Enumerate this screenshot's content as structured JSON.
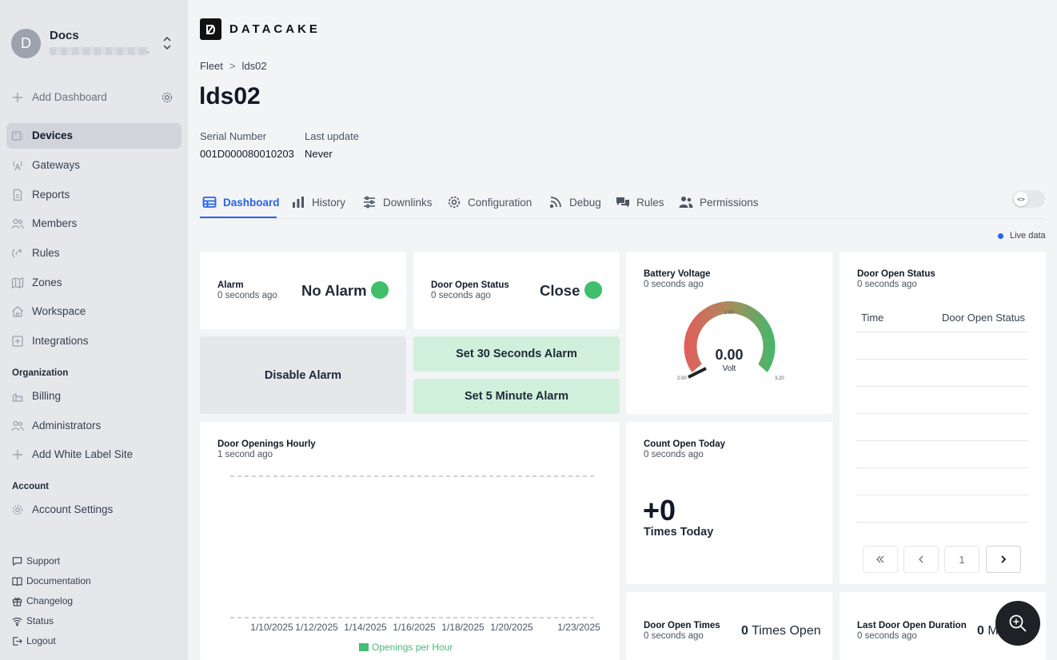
{
  "workspace": {
    "initial": "D",
    "name": "Docs",
    "sub_suffix": ".."
  },
  "sidebar": {
    "add_dashboard": "Add Dashboard",
    "items": [
      {
        "label": "Devices"
      },
      {
        "label": "Gateways"
      },
      {
        "label": "Reports"
      },
      {
        "label": "Members"
      },
      {
        "label": "Rules"
      },
      {
        "label": "Zones"
      },
      {
        "label": "Workspace"
      },
      {
        "label": "Integrations"
      }
    ],
    "org_heading": "Organization",
    "org_items": [
      {
        "label": "Billing"
      },
      {
        "label": "Administrators"
      },
      {
        "label": "Add White Label Site"
      }
    ],
    "account_heading": "Account",
    "account_items": [
      {
        "label": "Account Settings"
      }
    ],
    "footer": [
      {
        "label": "Support"
      },
      {
        "label": "Documentation"
      },
      {
        "label": "Changelog"
      },
      {
        "label": "Status"
      },
      {
        "label": "Logout"
      }
    ]
  },
  "brand": {
    "name": "DATACAKE"
  },
  "breadcrumb": {
    "parent": "Fleet",
    "sep": ">",
    "current": "lds02"
  },
  "device": {
    "title": "lds02",
    "serial_label": "Serial Number",
    "serial_value": "001D000080010203",
    "last_update_label": "Last update",
    "last_update_value": "Never"
  },
  "tabs": [
    {
      "label": "Dashboard",
      "icon": "table-icon"
    },
    {
      "label": "History",
      "icon": "bar-chart-icon"
    },
    {
      "label": "Downlinks",
      "icon": "sliders-icon"
    },
    {
      "label": "Configuration",
      "icon": "gear-icon"
    },
    {
      "label": "Debug",
      "icon": "rss-icon"
    },
    {
      "label": "Rules",
      "icon": "chat-icon"
    },
    {
      "label": "Permissions",
      "icon": "users-icon"
    }
  ],
  "live_data": "Live data",
  "widgets": {
    "alarm": {
      "title": "Alarm",
      "sub": "0 seconds ago",
      "value": "No Alarm"
    },
    "door_status": {
      "title": "Door Open Status",
      "sub": "0 seconds ago",
      "value": "Close"
    },
    "battery": {
      "title": "Battery Voltage",
      "sub": "0 seconds ago",
      "value": "0.00",
      "unit": "Volt",
      "min": "2.00",
      "mid": "2.60",
      "max": "3.20",
      "level": 0
    },
    "door_table": {
      "title": "Door Open Status",
      "sub": "0 seconds ago",
      "col_time": "Time",
      "col_status": "Door Open Status",
      "page": "1"
    },
    "buttons": {
      "disable": "Disable Alarm",
      "set30": "Set 30 Seconds Alarm",
      "set5": "Set 5 Minute Alarm"
    },
    "hourly": {
      "title": "Door Openings Hourly",
      "sub": "1 second ago"
    },
    "count_today": {
      "title": "Count Open Today",
      "sub": "0 seconds ago",
      "value": "+0",
      "label": "Times Today"
    },
    "open_times": {
      "title": "Door Open Times",
      "sub": "0 seconds ago",
      "value": "0",
      "unit": "Times Open"
    },
    "last_duration": {
      "title": "Last Door Open Duration",
      "sub": "0 seconds ago",
      "value": "0",
      "unit": "M"
    }
  },
  "chart_data": {
    "type": "bar",
    "categories": [
      "1/10/2025",
      "1/12/2025",
      "1/14/2025",
      "1/16/2025",
      "1/18/2025",
      "1/20/2025",
      "1/23/2025"
    ],
    "series": [
      {
        "name": "Openings per Hour",
        "values": [
          0,
          0,
          0,
          0,
          0,
          0,
          0
        ],
        "color": "#48bb78"
      }
    ],
    "title": "Door Openings Hourly",
    "xlabel": "",
    "ylabel": "",
    "grid": true,
    "legend": "bottom"
  }
}
